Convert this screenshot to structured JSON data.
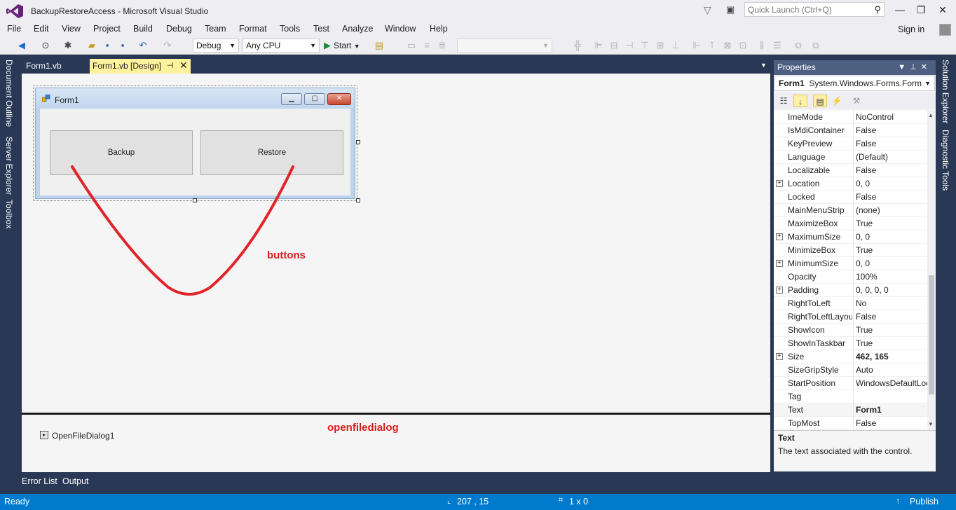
{
  "window": {
    "title": "BackupRestoreAccess - Microsoft Visual Studio",
    "quick_launch_placeholder": "Quick Launch (Ctrl+Q)",
    "controls": {
      "minimize": "—",
      "maximize": "❐",
      "close": "✕"
    }
  },
  "menu": {
    "items": [
      "File",
      "Edit",
      "View",
      "Project",
      "Build",
      "Debug",
      "Team",
      "Format",
      "Tools",
      "Test",
      "Analyze",
      "Window",
      "Help"
    ],
    "signin": "Sign in"
  },
  "toolbar": {
    "config": "Debug",
    "platform": "Any CPU",
    "start": "Start"
  },
  "left_tabs": [
    "Document Outline",
    "Server Explorer",
    "Toolbox"
  ],
  "right_tabs": [
    "Solution Explorer",
    "Diagnostic Tools"
  ],
  "doc_tabs": [
    {
      "label": "Form1.vb",
      "active": false
    },
    {
      "label": "Form1.vb [Design]",
      "active": true
    }
  ],
  "designer": {
    "form_title": "Form1",
    "buttons": [
      "Backup",
      "Restore"
    ],
    "annotation_buttons": "buttons",
    "annotation_color": "#d81e1e"
  },
  "tray": {
    "component": "OpenFileDialog1",
    "annotation": "openfiledialog"
  },
  "properties": {
    "title": "Properties",
    "object_name": "Form1",
    "object_type": "System.Windows.Forms.Form",
    "rows": [
      {
        "name": "ImeMode",
        "value": "NoControl",
        "expand": false,
        "bold": false
      },
      {
        "name": "IsMdiContainer",
        "value": "False",
        "expand": false,
        "bold": false
      },
      {
        "name": "KeyPreview",
        "value": "False",
        "expand": false,
        "bold": false
      },
      {
        "name": "Language",
        "value": "(Default)",
        "expand": false,
        "bold": false
      },
      {
        "name": "Localizable",
        "value": "False",
        "expand": false,
        "bold": false
      },
      {
        "name": "Location",
        "value": "0, 0",
        "expand": true,
        "bold": false
      },
      {
        "name": "Locked",
        "value": "False",
        "expand": false,
        "bold": false
      },
      {
        "name": "MainMenuStrip",
        "value": "(none)",
        "expand": false,
        "bold": false
      },
      {
        "name": "MaximizeBox",
        "value": "True",
        "expand": false,
        "bold": false
      },
      {
        "name": "MaximumSize",
        "value": "0, 0",
        "expand": true,
        "bold": false
      },
      {
        "name": "MinimizeBox",
        "value": "True",
        "expand": false,
        "bold": false
      },
      {
        "name": "MinimumSize",
        "value": "0, 0",
        "expand": true,
        "bold": false
      },
      {
        "name": "Opacity",
        "value": "100%",
        "expand": false,
        "bold": false
      },
      {
        "name": "Padding",
        "value": "0, 0, 0, 0",
        "expand": true,
        "bold": false
      },
      {
        "name": "RightToLeft",
        "value": "No",
        "expand": false,
        "bold": false
      },
      {
        "name": "RightToLeftLayout",
        "value": "False",
        "expand": false,
        "bold": false
      },
      {
        "name": "ShowIcon",
        "value": "True",
        "expand": false,
        "bold": false
      },
      {
        "name": "ShowInTaskbar",
        "value": "True",
        "expand": false,
        "bold": false
      },
      {
        "name": "Size",
        "value": "462, 165",
        "expand": true,
        "bold": true
      },
      {
        "name": "SizeGripStyle",
        "value": "Auto",
        "expand": false,
        "bold": false
      },
      {
        "name": "StartPosition",
        "value": "WindowsDefaultLocation",
        "expand": false,
        "bold": false
      },
      {
        "name": "Tag",
        "value": "",
        "expand": false,
        "bold": false
      },
      {
        "name": "Text",
        "value": "Form1",
        "expand": false,
        "bold": true,
        "selected": true
      },
      {
        "name": "TopMost",
        "value": "False",
        "expand": false,
        "bold": false
      }
    ],
    "desc_title": "Text",
    "desc_text": "The text associated with the control."
  },
  "bottom_tabs": [
    "Error List",
    "Output"
  ],
  "status": {
    "ready": "Ready",
    "position": "207 , 15",
    "size": "1 x 0",
    "publish": "Publish"
  }
}
